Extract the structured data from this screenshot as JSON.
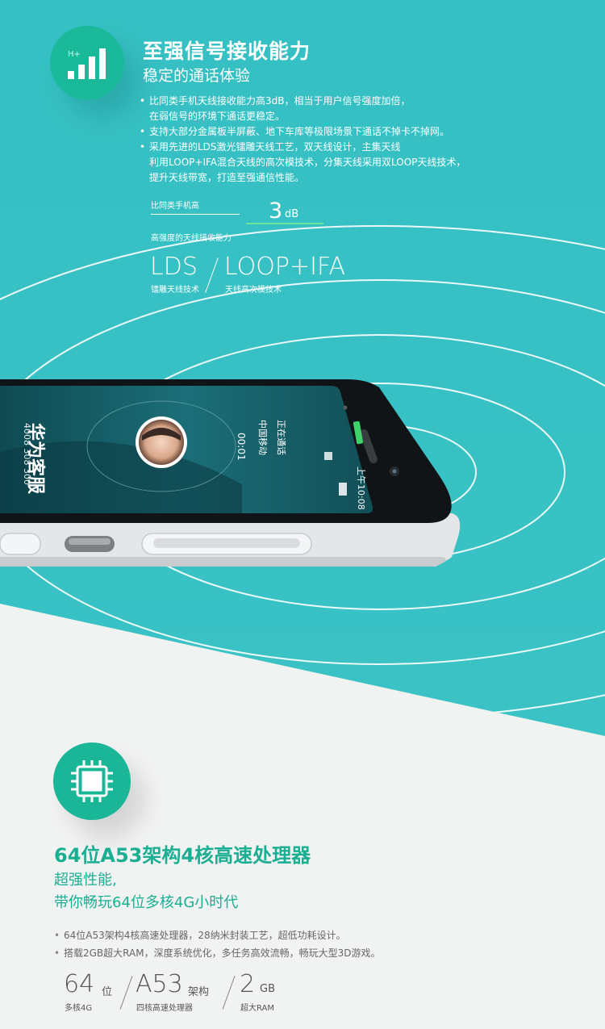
{
  "colors": {
    "teal_background": "#37c2c5",
    "brand_green": "#1ab698",
    "accent_green": "#6be59c",
    "white_background": "#f1f2f2"
  },
  "section1": {
    "icon": "signal-bars-icon",
    "icon_label": "H+",
    "title": "至强信号接收能力",
    "subtitle": "稳定的通话体验",
    "bullets": [
      "比同类手机天线接收能力高3dB，相当于用户信号强度加倍，\n在弱信号的环境下通话更稳定。",
      "支持大部分金属板半屏蔽、地下车库等极限场景下通话不掉卡不掉网。",
      "采用先进的LDS激光镭雕天线工艺，双天线设计，主集天线\n利用LOOP+IFA混合天线的高次模技术，分集天线采用双LOOP天线技术，\n提升天线带宽，打造至强通信性能。"
    ],
    "stat": {
      "label": "比同类手机高",
      "value": "3",
      "unit": "dB",
      "caption": "高强度的天线接收能力"
    },
    "tech": [
      {
        "name": "LDS",
        "caption": "镭雕天线技术"
      },
      {
        "name": "LOOP+IFA",
        "caption": "天线高次模技术"
      }
    ]
  },
  "phone_screen": {
    "caller_name": "华为客服",
    "caller_number": "4008 308 300",
    "call_status": "正在通话",
    "carrier": "中国移动",
    "timer": "00:01",
    "status_time": "上午10:08"
  },
  "section2": {
    "icon": "cpu-chip-icon",
    "title": "64位A53架构4核高速处理器",
    "subtitle_line1": "超强性能,",
    "subtitle_line2": "带你畅玩64位多核4G小时代",
    "bullets": [
      "64位A53架构4核高速处理器，28纳米封装工艺，超低功耗设计。",
      "搭载2GB超大RAM，深度系统优化，多任务高效流畅，畅玩大型3D游戏。"
    ],
    "specs": [
      {
        "value": "64",
        "unit": "位",
        "caption": "多核4G"
      },
      {
        "value": "A53",
        "unit": "架构",
        "caption": "四核高速处理器"
      },
      {
        "value": "2",
        "unit": "GB",
        "caption": "超大RAM"
      }
    ]
  }
}
